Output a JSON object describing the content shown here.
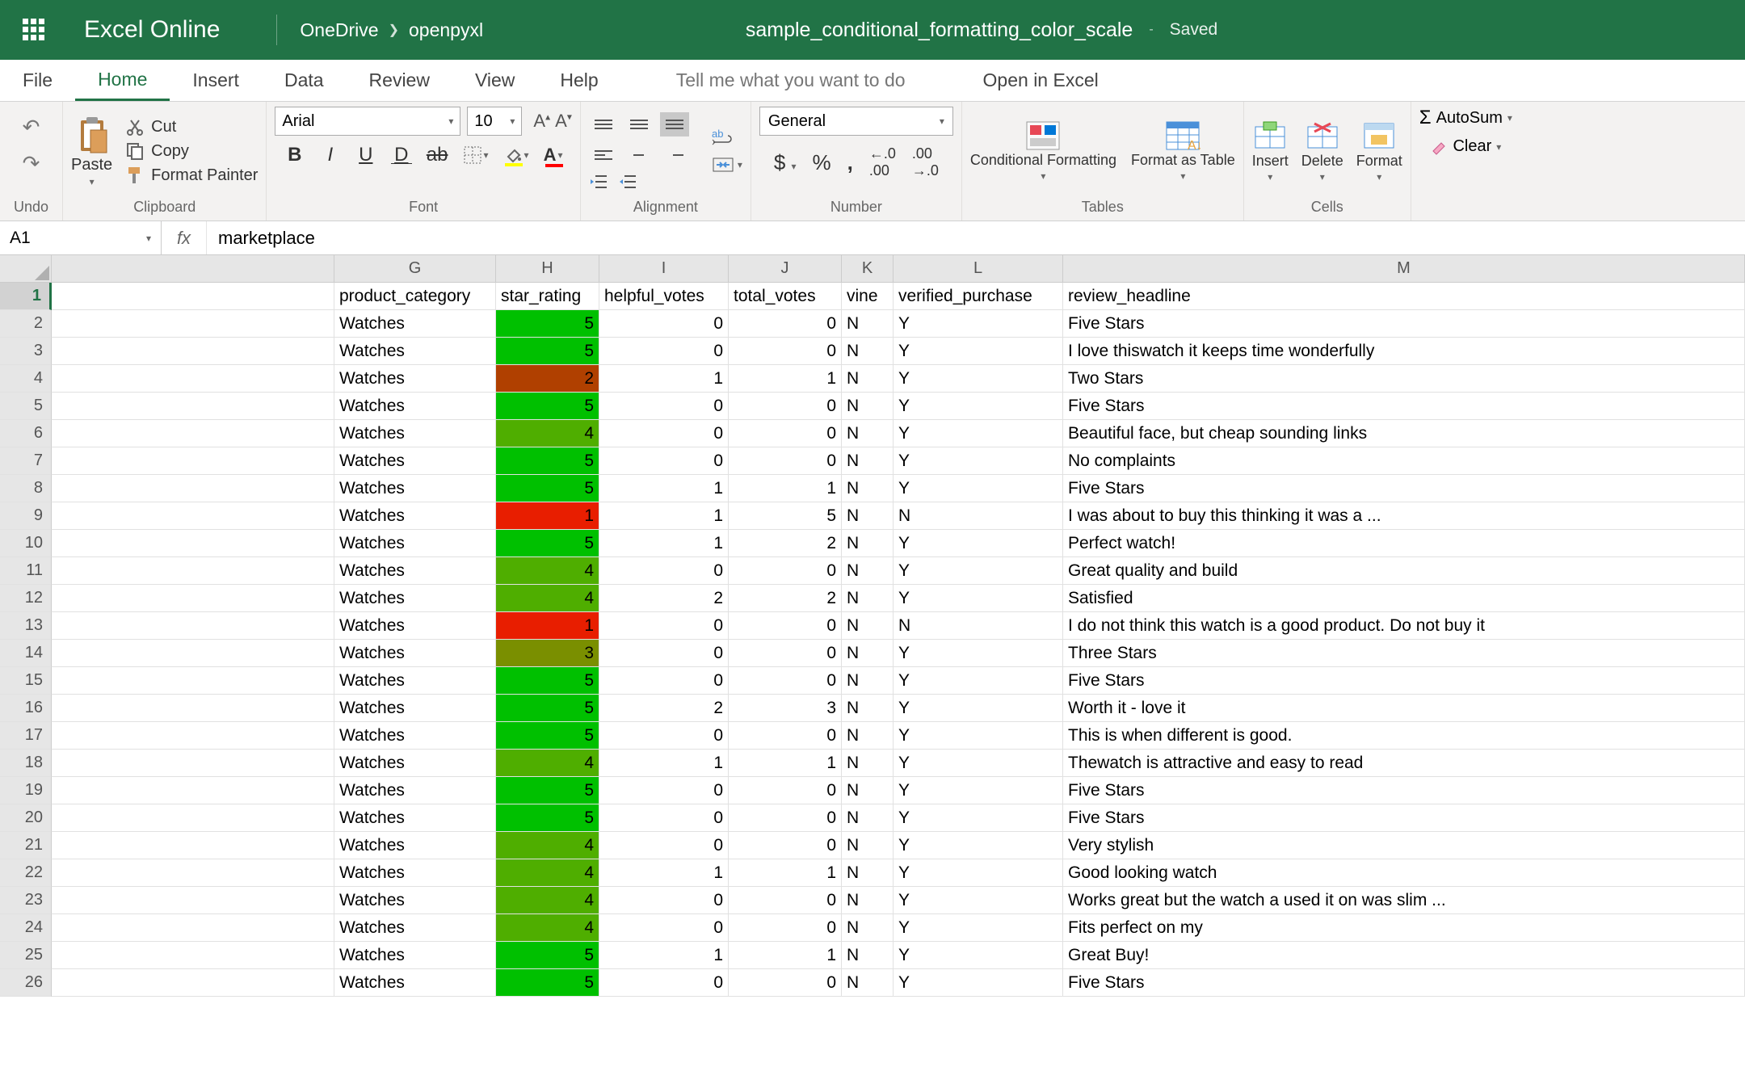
{
  "titlebar": {
    "app_name": "Excel Online",
    "breadcrumb": [
      "OneDrive",
      "openpyxl"
    ],
    "doc_title": "sample_conditional_formatting_color_scale",
    "save_status": "Saved"
  },
  "tabs": {
    "items": [
      "File",
      "Home",
      "Insert",
      "Data",
      "Review",
      "View",
      "Help"
    ],
    "tellme": "Tell me what you want to do",
    "open_excel": "Open in Excel",
    "active": "Home"
  },
  "ribbon": {
    "undo": "Undo",
    "clipboard": {
      "paste": "Paste",
      "cut": "Cut",
      "copy": "Copy",
      "format_painter": "Format Painter",
      "label": "Clipboard"
    },
    "font": {
      "family": "Arial",
      "size": "10",
      "label": "Font"
    },
    "alignment": {
      "label": "Alignment"
    },
    "number": {
      "format": "General",
      "label": "Number"
    },
    "tables": {
      "cond_fmt": "Conditional Formatting",
      "as_table": "Format as Table",
      "label": "Tables"
    },
    "cells": {
      "insert": "Insert",
      "delete": "Delete",
      "format": "Format",
      "label": "Cells"
    },
    "editing": {
      "autosum": "AutoSum",
      "clear": "Clear"
    }
  },
  "formula_bar": {
    "name_box": "A1",
    "formula": "marketplace"
  },
  "columns": [
    "G",
    "H",
    "I",
    "J",
    "K",
    "L",
    "M"
  ],
  "headers": {
    "G": "product_category",
    "H": "star_rating",
    "I": "helpful_votes",
    "J": "total_votes",
    "K": "vine",
    "L": "verified_purchase",
    "M": "review_headline"
  },
  "rows": [
    {
      "n": 2,
      "G": "Watches",
      "H": 5,
      "I": 0,
      "J": 0,
      "K": "N",
      "L": "Y",
      "M": "Five Stars"
    },
    {
      "n": 3,
      "G": "Watches",
      "H": 5,
      "I": 0,
      "J": 0,
      "K": "N",
      "L": "Y",
      "M": "I love thiswatch it keeps time wonderfully"
    },
    {
      "n": 4,
      "G": "Watches",
      "H": 2,
      "I": 1,
      "J": 1,
      "K": "N",
      "L": "Y",
      "M": "Two Stars"
    },
    {
      "n": 5,
      "G": "Watches",
      "H": 5,
      "I": 0,
      "J": 0,
      "K": "N",
      "L": "Y",
      "M": "Five Stars"
    },
    {
      "n": 6,
      "G": "Watches",
      "H": 4,
      "I": 0,
      "J": 0,
      "K": "N",
      "L": "Y",
      "M": "Beautiful face, but cheap sounding links"
    },
    {
      "n": 7,
      "G": "Watches",
      "H": 5,
      "I": 0,
      "J": 0,
      "K": "N",
      "L": "Y",
      "M": "No complaints"
    },
    {
      "n": 8,
      "G": "Watches",
      "H": 5,
      "I": 1,
      "J": 1,
      "K": "N",
      "L": "Y",
      "M": "Five Stars"
    },
    {
      "n": 9,
      "G": "Watches",
      "H": 1,
      "I": 1,
      "J": 5,
      "K": "N",
      "L": "N",
      "M": "I was about to buy this thinking it was a ..."
    },
    {
      "n": 10,
      "G": "Watches",
      "H": 5,
      "I": 1,
      "J": 2,
      "K": "N",
      "L": "Y",
      "M": "Perfect watch!"
    },
    {
      "n": 11,
      "G": "Watches",
      "H": 4,
      "I": 0,
      "J": 0,
      "K": "N",
      "L": "Y",
      "M": "Great quality and build"
    },
    {
      "n": 12,
      "G": "Watches",
      "H": 4,
      "I": 2,
      "J": 2,
      "K": "N",
      "L": "Y",
      "M": "Satisfied"
    },
    {
      "n": 13,
      "G": "Watches",
      "H": 1,
      "I": 0,
      "J": 0,
      "K": "N",
      "L": "N",
      "M": "I do not think this watch is a good product. Do not buy it"
    },
    {
      "n": 14,
      "G": "Watches",
      "H": 3,
      "I": 0,
      "J": 0,
      "K": "N",
      "L": "Y",
      "M": "Three Stars"
    },
    {
      "n": 15,
      "G": "Watches",
      "H": 5,
      "I": 0,
      "J": 0,
      "K": "N",
      "L": "Y",
      "M": "Five Stars"
    },
    {
      "n": 16,
      "G": "Watches",
      "H": 5,
      "I": 2,
      "J": 3,
      "K": "N",
      "L": "Y",
      "M": "Worth it - love it"
    },
    {
      "n": 17,
      "G": "Watches",
      "H": 5,
      "I": 0,
      "J": 0,
      "K": "N",
      "L": "Y",
      "M": "This is when different is good."
    },
    {
      "n": 18,
      "G": "Watches",
      "H": 4,
      "I": 1,
      "J": 1,
      "K": "N",
      "L": "Y",
      "M": "Thewatch is attractive and easy to read"
    },
    {
      "n": 19,
      "G": "Watches",
      "H": 5,
      "I": 0,
      "J": 0,
      "K": "N",
      "L": "Y",
      "M": "Five Stars"
    },
    {
      "n": 20,
      "G": "Watches",
      "H": 5,
      "I": 0,
      "J": 0,
      "K": "N",
      "L": "Y",
      "M": "Five Stars"
    },
    {
      "n": 21,
      "G": "Watches",
      "H": 4,
      "I": 0,
      "J": 0,
      "K": "N",
      "L": "Y",
      "M": "Very stylish"
    },
    {
      "n": 22,
      "G": "Watches",
      "H": 4,
      "I": 1,
      "J": 1,
      "K": "N",
      "L": "Y",
      "M": "Good looking watch"
    },
    {
      "n": 23,
      "G": "Watches",
      "H": 4,
      "I": 0,
      "J": 0,
      "K": "N",
      "L": "Y",
      "M": "Works great but the watch a used it on was slim ..."
    },
    {
      "n": 24,
      "G": "Watches",
      "H": 4,
      "I": 0,
      "J": 0,
      "K": "N",
      "L": "Y",
      "M": "Fits perfect on my"
    },
    {
      "n": 25,
      "G": "Watches",
      "H": 5,
      "I": 1,
      "J": 1,
      "K": "N",
      "L": "Y",
      "M": "Great Buy!"
    },
    {
      "n": 26,
      "G": "Watches",
      "H": 5,
      "I": 0,
      "J": 0,
      "K": "N",
      "L": "Y",
      "M": "Five Stars"
    }
  ],
  "rating_colors": {
    "1": "#e81e00",
    "2": "#b04000",
    "3": "#7a8f00",
    "4": "#4fae00",
    "5": "#00c000"
  }
}
